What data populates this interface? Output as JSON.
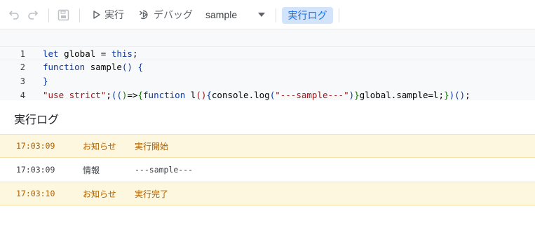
{
  "toolbar": {
    "undo_icon": "undo-icon",
    "redo_icon": "redo-icon",
    "save_icon": "save-icon",
    "run_label": "実行",
    "debug_label": "デバッグ",
    "function_select": "sample",
    "log_button_label": "実行ログ"
  },
  "editor": {
    "lines": [
      {
        "number": "1",
        "code": "let global = this;"
      },
      {
        "number": "2",
        "code": "function sample() {"
      },
      {
        "number": "3",
        "code": "}"
      },
      {
        "number": "4",
        "code": "\"use strict\";(()=>{function l(){console.log(\"---sample---\")}global.sample=l;})();"
      }
    ]
  },
  "log_panel": {
    "title": "実行ログ",
    "rows": [
      {
        "time": "17:03:09",
        "level": "お知らせ",
        "message": "実行開始",
        "kind": "notice"
      },
      {
        "time": "17:03:09",
        "level": "情報",
        "message": "---sample---",
        "kind": "info"
      },
      {
        "time": "17:03:10",
        "level": "お知らせ",
        "message": "実行完了",
        "kind": "notice"
      }
    ]
  },
  "colors": {
    "accent": "#1a73e8",
    "log_button_bg": "#d2e3fc",
    "notice_bg": "#fef7e0",
    "notice_text": "#b06000"
  }
}
